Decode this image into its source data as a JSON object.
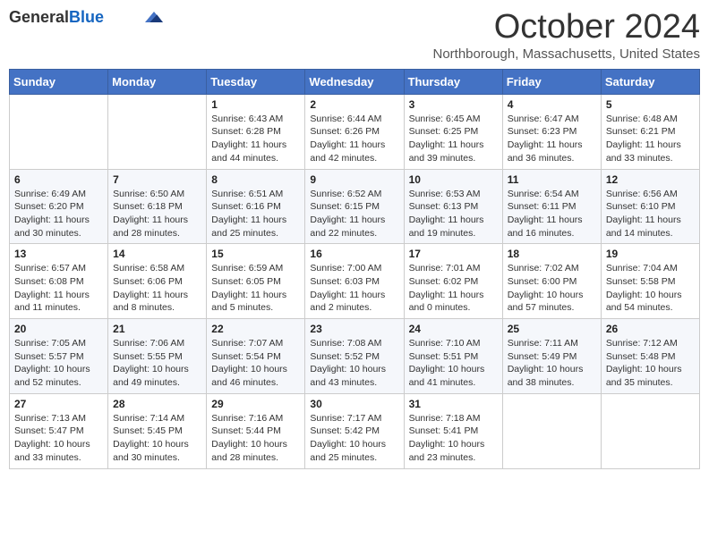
{
  "header": {
    "logo_line1": "General",
    "logo_line2": "Blue",
    "month_title": "October 2024",
    "location": "Northborough, Massachusetts, United States"
  },
  "weekdays": [
    "Sunday",
    "Monday",
    "Tuesday",
    "Wednesday",
    "Thursday",
    "Friday",
    "Saturday"
  ],
  "weeks": [
    [
      {
        "day": "",
        "info": ""
      },
      {
        "day": "",
        "info": ""
      },
      {
        "day": "1",
        "info": "Sunrise: 6:43 AM\nSunset: 6:28 PM\nDaylight: 11 hours and 44 minutes."
      },
      {
        "day": "2",
        "info": "Sunrise: 6:44 AM\nSunset: 6:26 PM\nDaylight: 11 hours and 42 minutes."
      },
      {
        "day": "3",
        "info": "Sunrise: 6:45 AM\nSunset: 6:25 PM\nDaylight: 11 hours and 39 minutes."
      },
      {
        "day": "4",
        "info": "Sunrise: 6:47 AM\nSunset: 6:23 PM\nDaylight: 11 hours and 36 minutes."
      },
      {
        "day": "5",
        "info": "Sunrise: 6:48 AM\nSunset: 6:21 PM\nDaylight: 11 hours and 33 minutes."
      }
    ],
    [
      {
        "day": "6",
        "info": "Sunrise: 6:49 AM\nSunset: 6:20 PM\nDaylight: 11 hours and 30 minutes."
      },
      {
        "day": "7",
        "info": "Sunrise: 6:50 AM\nSunset: 6:18 PM\nDaylight: 11 hours and 28 minutes."
      },
      {
        "day": "8",
        "info": "Sunrise: 6:51 AM\nSunset: 6:16 PM\nDaylight: 11 hours and 25 minutes."
      },
      {
        "day": "9",
        "info": "Sunrise: 6:52 AM\nSunset: 6:15 PM\nDaylight: 11 hours and 22 minutes."
      },
      {
        "day": "10",
        "info": "Sunrise: 6:53 AM\nSunset: 6:13 PM\nDaylight: 11 hours and 19 minutes."
      },
      {
        "day": "11",
        "info": "Sunrise: 6:54 AM\nSunset: 6:11 PM\nDaylight: 11 hours and 16 minutes."
      },
      {
        "day": "12",
        "info": "Sunrise: 6:56 AM\nSunset: 6:10 PM\nDaylight: 11 hours and 14 minutes."
      }
    ],
    [
      {
        "day": "13",
        "info": "Sunrise: 6:57 AM\nSunset: 6:08 PM\nDaylight: 11 hours and 11 minutes."
      },
      {
        "day": "14",
        "info": "Sunrise: 6:58 AM\nSunset: 6:06 PM\nDaylight: 11 hours and 8 minutes."
      },
      {
        "day": "15",
        "info": "Sunrise: 6:59 AM\nSunset: 6:05 PM\nDaylight: 11 hours and 5 minutes."
      },
      {
        "day": "16",
        "info": "Sunrise: 7:00 AM\nSunset: 6:03 PM\nDaylight: 11 hours and 2 minutes."
      },
      {
        "day": "17",
        "info": "Sunrise: 7:01 AM\nSunset: 6:02 PM\nDaylight: 11 hours and 0 minutes."
      },
      {
        "day": "18",
        "info": "Sunrise: 7:02 AM\nSunset: 6:00 PM\nDaylight: 10 hours and 57 minutes."
      },
      {
        "day": "19",
        "info": "Sunrise: 7:04 AM\nSunset: 5:58 PM\nDaylight: 10 hours and 54 minutes."
      }
    ],
    [
      {
        "day": "20",
        "info": "Sunrise: 7:05 AM\nSunset: 5:57 PM\nDaylight: 10 hours and 52 minutes."
      },
      {
        "day": "21",
        "info": "Sunrise: 7:06 AM\nSunset: 5:55 PM\nDaylight: 10 hours and 49 minutes."
      },
      {
        "day": "22",
        "info": "Sunrise: 7:07 AM\nSunset: 5:54 PM\nDaylight: 10 hours and 46 minutes."
      },
      {
        "day": "23",
        "info": "Sunrise: 7:08 AM\nSunset: 5:52 PM\nDaylight: 10 hours and 43 minutes."
      },
      {
        "day": "24",
        "info": "Sunrise: 7:10 AM\nSunset: 5:51 PM\nDaylight: 10 hours and 41 minutes."
      },
      {
        "day": "25",
        "info": "Sunrise: 7:11 AM\nSunset: 5:49 PM\nDaylight: 10 hours and 38 minutes."
      },
      {
        "day": "26",
        "info": "Sunrise: 7:12 AM\nSunset: 5:48 PM\nDaylight: 10 hours and 35 minutes."
      }
    ],
    [
      {
        "day": "27",
        "info": "Sunrise: 7:13 AM\nSunset: 5:47 PM\nDaylight: 10 hours and 33 minutes."
      },
      {
        "day": "28",
        "info": "Sunrise: 7:14 AM\nSunset: 5:45 PM\nDaylight: 10 hours and 30 minutes."
      },
      {
        "day": "29",
        "info": "Sunrise: 7:16 AM\nSunset: 5:44 PM\nDaylight: 10 hours and 28 minutes."
      },
      {
        "day": "30",
        "info": "Sunrise: 7:17 AM\nSunset: 5:42 PM\nDaylight: 10 hours and 25 minutes."
      },
      {
        "day": "31",
        "info": "Sunrise: 7:18 AM\nSunset: 5:41 PM\nDaylight: 10 hours and 23 minutes."
      },
      {
        "day": "",
        "info": ""
      },
      {
        "day": "",
        "info": ""
      }
    ]
  ]
}
